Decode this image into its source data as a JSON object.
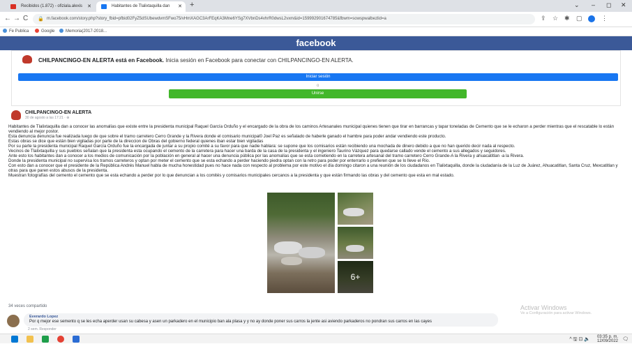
{
  "browser": {
    "tabs": [
      {
        "label": "Recibidos (1.872) - ofiziala.alexis",
        "active": false
      },
      {
        "label": "Habitantes de Tlalixtaquilla dan",
        "active": true
      }
    ],
    "new_tab": "+",
    "window_controls": [
      "⌄",
      "–",
      "◻",
      "✕"
    ],
    "nav": {
      "back": "←",
      "forward": "→",
      "reload": "C"
    },
    "url": "m.facebook.com/story.php?story_fbid=pfbid02FyZ5dSUbewdvmSFwo75/vHmXAGC3ArFEqKA3Mne6YSg7XVbnDs4vhrR0dwsL2vxm&id=159992901674785&fbwm=sowspwalbezlid=a",
    "bookmarks": [
      "Fe Publica",
      "Google",
      "Memoria(2017-2018..."
    ]
  },
  "facebook": {
    "brand": "facebook",
    "page_name": "CHILPANCINGO-EN ALERTA",
    "banner_bold": "CHILPANCINGO-EN ALERTA está en Facebook.",
    "banner_text": " Inicia sesión en Facebook para conectar con CHILPANCINGO-EN ALERTA.",
    "login_button": "Iniciar sesión",
    "separator": "o",
    "join_button": "Unirse",
    "post": {
      "author": "CHILPANCINGO-EN ALERTA",
      "date": "30 de agosto a las 17:21 · ",
      "paragraphs": [
        "Habitantes de Tlalixtaquilla dan a conocer las anomalías que existe entre la presidenta municipal Raquel García Orduño y el encargado de la obra de los caminos Artesanales municipal quienes tienen que tirar en barrancas y tapar toneladas de Cemento que se le echaron a perder mientras que el rescatable lo están vendiendo al mejor postor.",
        "Esta denuncia denuncia fue realizada luego de que sobre el tramo carretero Cerro Grande y la Rivera donde el comisario municipal0 Joel Paz es señalado de haberle ganado el hambre para poder andar vendiendo este producto.",
        "Estas obras se dice que están bien vigiladas por parte de la direccion de Obras del gobierno federal quienes iban estar bien vigiladas",
        "Por su parte la presidenta municipal Raquel García Orduño fue la encargada de juntar a su propio comité a su favor para que nadie hablara: se supone que los comisarios están recibiendo una mochada de dinero debido a que no han querido decir nada al respecto.",
        "Vecinos de Tlalixtaquilla y sus pueblos señalan que la presidenta esta ocupando el cemento de la carretera para hacer una barda de la casa de la presidenta y el ingeniero Taurino Vázquez para quedarse callado vende el cemento a sus allegados y seguidores.",
        "Ante esto los habitantes dan a conocer a los medios de comunicación por la población en general al hacer una denuncia pública por las anomalías que se esta cometiendo en la carretera artesanal del tramo carretero Cerro Grande-A la Rivera y ahuacatitlan -a la Rivera.",
        "Donde la presidenta municipal no supervisa los tramos carreteros y optan por meter el cemento que se esta echando a perder haciendo piedra optan con la retro para poder por enterrarlo o prefieren que se lo lleve el Río.",
        "Con esto dan a conocer que el presidente de la República Andrés Manuel habla de mucha honestidad pues no hace nada con respecto al problema por este motivo el día domingo citaron a una reunión de los ciudadanos en Tlalixtaquilla, donde la ciudadanía de la Luz de Juárez, Ahuacatitlan, Santa Cruz, Mexcatitlan y otras para que paren estos abusos de la presidenta.",
        "Muestran fotografías del cemento el cemento que se esta echando a perder por lo que denuncian a los comités y comisarios municipales cercanos a la presidenta y que están firmando las obras y del cemento que esta en mal estado."
      ],
      "more_photos": "6+",
      "shares": "34 veces compartido"
    },
    "comment": {
      "author": "Everardo Lopez",
      "text": "Por q mejor ese semento q se les echa aperder usan su cabesa y asen un parkadero en el municipio ban ala plasa y y no ay donde poner sus carros la jente asi aviendo parkaderos no pondran sus carros en las cayes",
      "actions": "2 sem.   Responder"
    }
  },
  "system": {
    "watermark_title": "Activar Windows",
    "watermark_sub": "Ve a Configuración para activar Windows.",
    "tray_icons": "^ 🖫 ⊡ 🔈",
    "time": "03:35 p. m.",
    "date": "12/09/2022",
    "notification": "🗨"
  },
  "colors": {
    "facebook_blue": "#3b5998",
    "login_blue": "#1877f2",
    "join_green": "#42b72a"
  }
}
